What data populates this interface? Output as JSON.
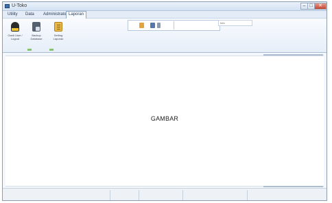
{
  "window": {
    "title": "U-Toko",
    "center_title": "",
    "controls": [
      "–",
      "□",
      "✕"
    ]
  },
  "menu": {
    "items": [
      "Utility",
      "Data",
      "Administrator",
      "Laporan"
    ],
    "active_index": 3
  },
  "ribbon": {
    "buttons": [
      {
        "label": "Ganti User / Logout",
        "icon": "user-icon"
      },
      {
        "label": "Backup Database",
        "icon": "database-icon"
      },
      {
        "label": "Setting Laporan",
        "icon": "report-icon"
      }
    ],
    "search_value": "Info"
  },
  "content": {
    "placeholder_text": "GAMBAR"
  },
  "statusbar": {
    "cells": [
      "",
      "",
      "",
      "",
      "",
      ""
    ]
  }
}
